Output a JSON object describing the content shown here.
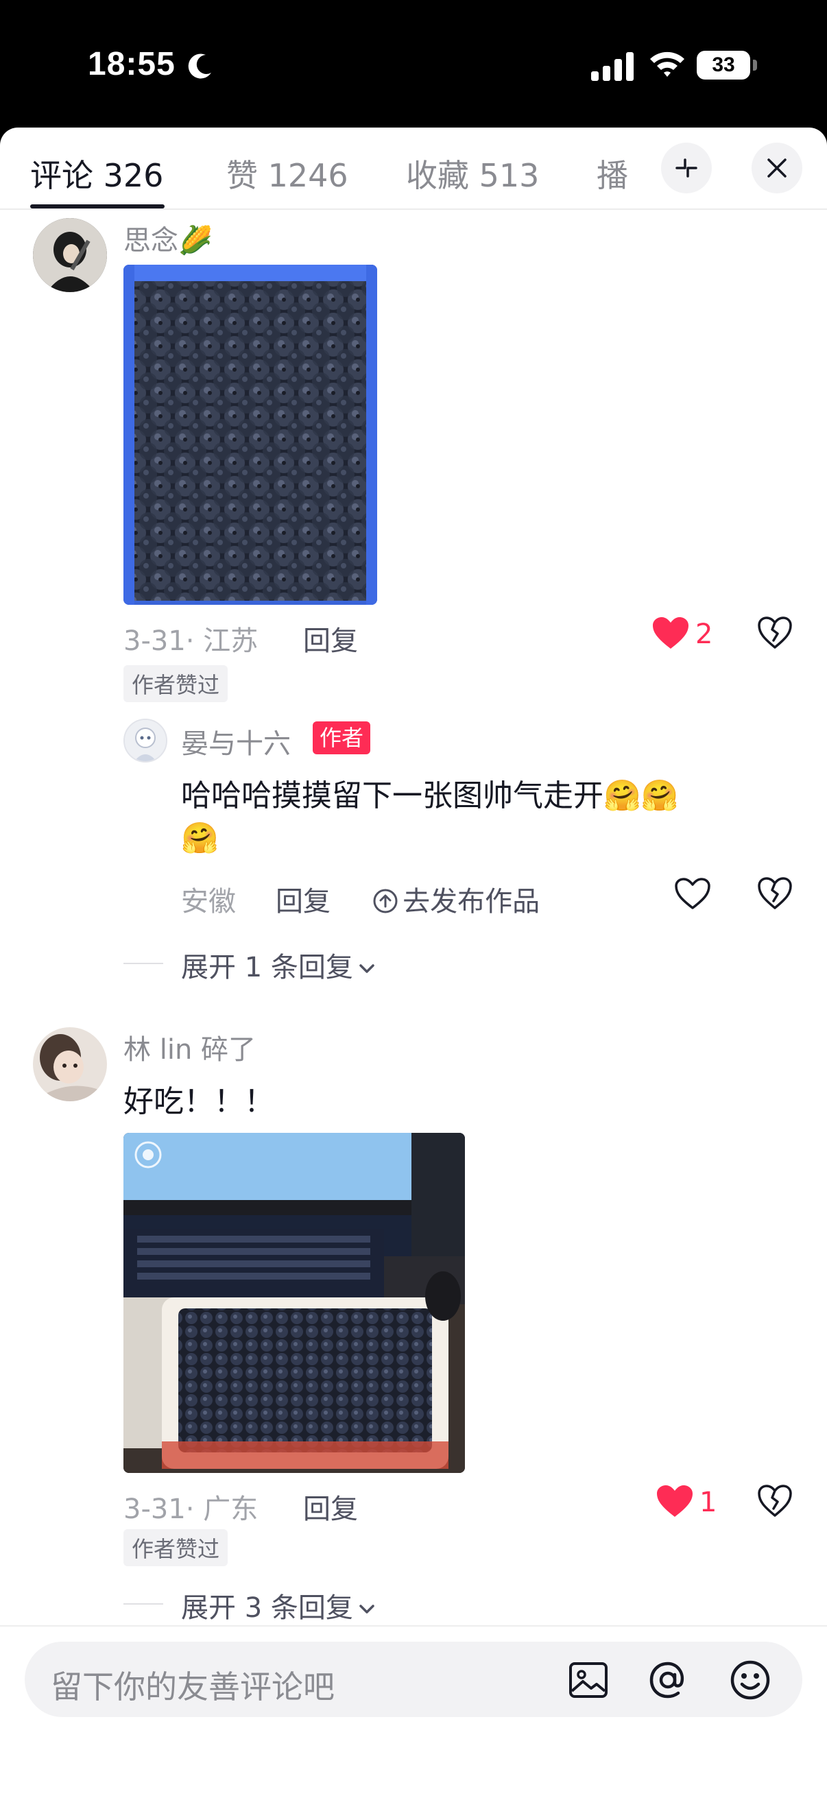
{
  "status_bar": {
    "time": "18:55",
    "battery": "33"
  },
  "tabs": [
    {
      "label": "评论 326"
    },
    {
      "label": "赞 1246"
    },
    {
      "label": "收藏 513"
    },
    {
      "label": "播"
    }
  ],
  "comments": [
    {
      "username": "思念🌽",
      "date_location": "3-31· 江苏",
      "reply_label": "回复",
      "likes": "2",
      "liked_badge": "作者赞过"
    },
    {
      "username": "林 lin 碎了",
      "text": "好吃！！！",
      "date_location": "3-31· 广东",
      "reply_label": "回复",
      "likes": "1",
      "liked_badge": "作者赞过",
      "expand_label": "展开 3 条回复"
    }
  ],
  "reply": {
    "username": "晏与十六",
    "author_tag": "作者",
    "text_line1": "哈哈哈摸摸留下一张图帅气走开🤗🤗",
    "text_line2": "🤗",
    "location": "安徽",
    "reply_label": "回复",
    "publish_label": "去发布作品",
    "expand_label": "展开 1 条回复"
  },
  "input": {
    "placeholder": "留下你的友善评论吧"
  },
  "colors": {
    "accent": "#fe2c55",
    "text": "#161823",
    "muted": "#8a8b91"
  }
}
